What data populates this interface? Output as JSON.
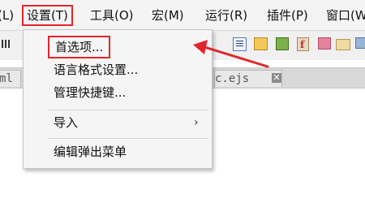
{
  "menubar": {
    "items": [
      {
        "label": "(L)"
      },
      {
        "label": "设置(T)"
      },
      {
        "label": "工具(O)"
      },
      {
        "label": "宏(M)"
      },
      {
        "label": "运行(R)"
      },
      {
        "label": "插件(P)"
      },
      {
        "label": "窗口(W"
      }
    ]
  },
  "toolbar": {
    "icons": [
      "view-icon",
      "format-icon",
      "folder-icon",
      "image-icon",
      "function-icon",
      "bookmark-icon",
      "open-folder-icon",
      "globe-icon"
    ]
  },
  "tabs": [
    {
      "label": "ml"
    },
    {
      "label": "c.ejs",
      "close": "✕"
    }
  ],
  "dropdown": {
    "items": [
      {
        "label": "首选项..."
      },
      {
        "label": "语言格式设置..."
      },
      {
        "label": "管理快捷键..."
      },
      {
        "label": "导入",
        "submenu_arrow": "›"
      },
      {
        "label": "编辑弹出菜单"
      }
    ]
  },
  "annotation": {
    "color": "#e0262c"
  }
}
